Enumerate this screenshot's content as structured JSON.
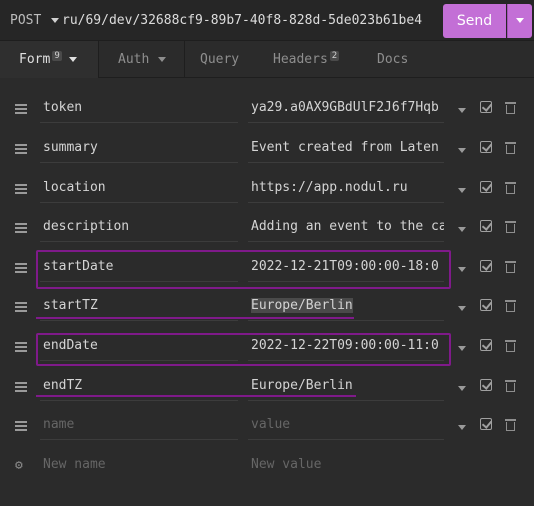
{
  "request": {
    "method": "POST",
    "url": "ru/69/dev/32688cf9-89b7-40f8-828d-5de023b61be4",
    "send_label": "Send"
  },
  "tabs": [
    {
      "label": "Form",
      "badge": "9"
    },
    {
      "label": "Auth"
    },
    {
      "label": "Query"
    },
    {
      "label": "Headers",
      "badge": "2"
    },
    {
      "label": "Docs"
    }
  ],
  "params": [
    {
      "name": "token",
      "value": "ya29.a0AX9GBdUlF2J6f7Hqb"
    },
    {
      "name": "summary",
      "value": "Event created from Laten"
    },
    {
      "name": "location",
      "value": "https://app.nodul.ru"
    },
    {
      "name": "description",
      "value": "Adding an event to the ca"
    },
    {
      "name": "startDate",
      "value": "2022-12-21T09:00:00-18:0"
    },
    {
      "name": "startTZ",
      "value": "Europe/Berlin"
    },
    {
      "name": "endDate",
      "value": "2022-12-22T09:00:00-11:0"
    },
    {
      "name": "endTZ",
      "value": "Europe/Berlin"
    },
    {
      "name_placeholder": "name",
      "value_placeholder": "value"
    },
    {
      "name_placeholder": "New name",
      "value_placeholder": "New value"
    }
  ],
  "colors": {
    "accent": "#c36fd6",
    "annotation": "#7f1a8a",
    "background": "#2b2b2b"
  },
  "icons": [
    "dropdown-caret-icon",
    "drag-handle-icon",
    "checkbox-icon",
    "trash-icon",
    "gear-icon"
  ]
}
